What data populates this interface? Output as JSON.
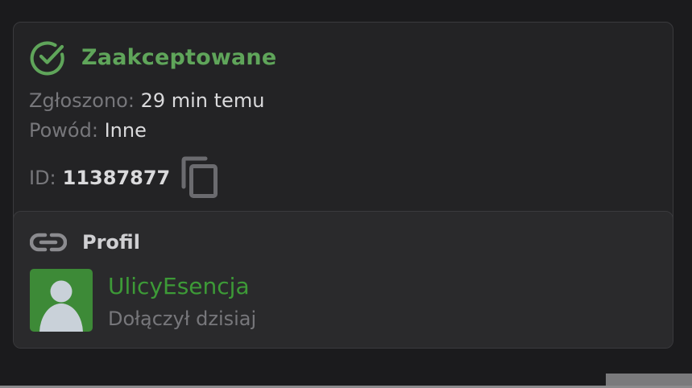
{
  "report": {
    "status": "Zaakceptowane",
    "status_color": "#5fa55a",
    "status_icon": "check-circle-icon",
    "reported_label": "Zgłoszono:",
    "reported_value": "29 min temu",
    "reason_label": "Powód:",
    "reason_value": "Inne",
    "id_label": "ID:",
    "id_value": "11387877",
    "copy_icon": "copy-icon"
  },
  "profile": {
    "section_icon": "link-icon",
    "section_title": "Profil",
    "username": "UlicyEsencja",
    "username_color": "#3d9a37",
    "joined_text": "Dołączył dzisiaj",
    "avatar_color": "#3d8a37"
  }
}
